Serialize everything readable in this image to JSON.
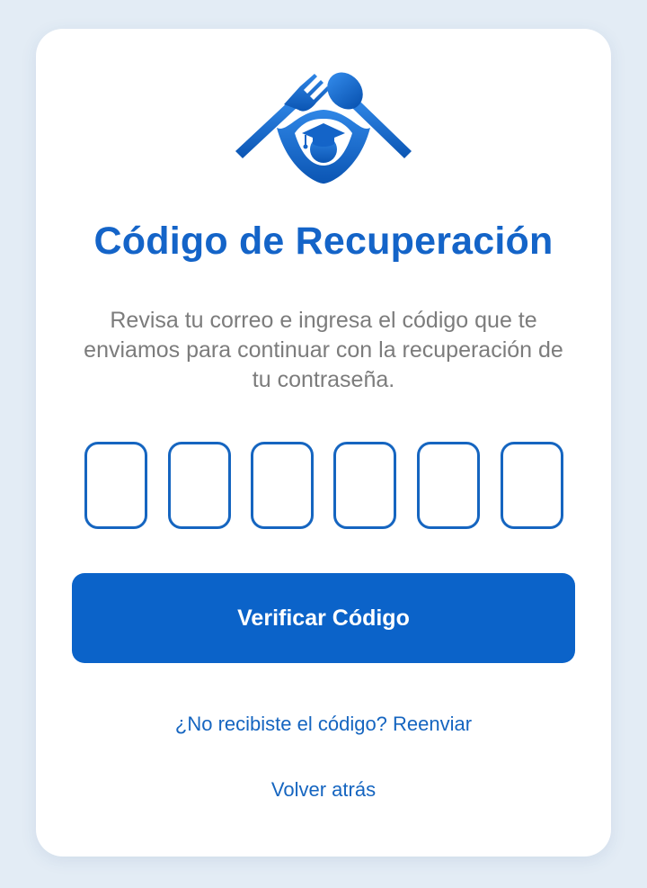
{
  "colors": {
    "background": "#e3ecf5",
    "card": "#ffffff",
    "accent": "#1464c8",
    "button": "#0b63c9",
    "muted_text": "#7c7c7c"
  },
  "logo": {
    "icon": "fork-spoon-graduate-logo-icon"
  },
  "title": "Código de Recuperación",
  "subtitle": "Revisa tu correo e ingresa el código que te enviamos para continuar con la recuperación de tu contraseña.",
  "code_inputs": {
    "count": 6,
    "values": [
      "",
      "",
      "",
      "",
      "",
      ""
    ]
  },
  "verify_button_label": "Verificar Código",
  "resend_link": "¿No recibiste el código? Reenviar",
  "back_link": "Volver atrás"
}
